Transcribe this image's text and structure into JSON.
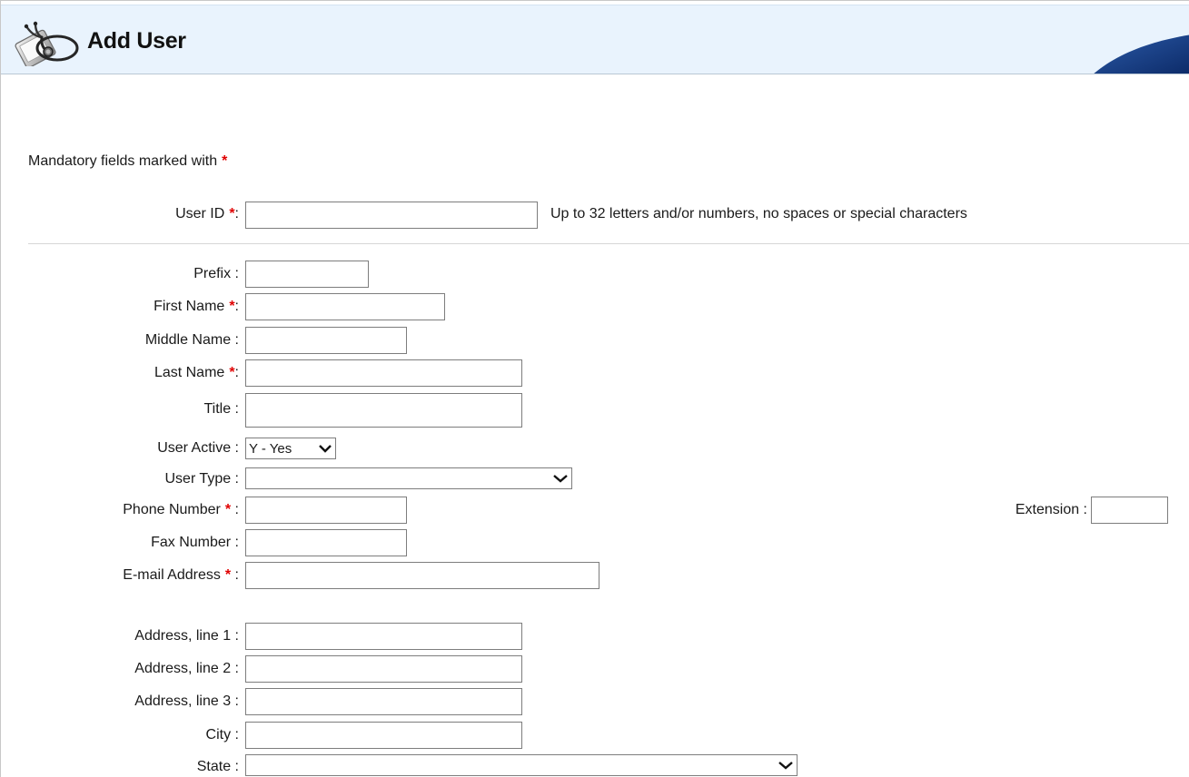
{
  "header": {
    "title": "Add User",
    "icon": "stethoscope-clipboard-icon"
  },
  "mandatory_note": {
    "text": "Mandatory fields marked with",
    "marker": "*"
  },
  "user_id": {
    "label": "User ID",
    "required": true,
    "value": "",
    "hint": "Up to 32 letters and/or numbers, no spaces or special characters"
  },
  "fields": {
    "prefix": {
      "label": "Prefix",
      "value": ""
    },
    "first_name": {
      "label": "First Name",
      "value": ""
    },
    "middle_name": {
      "label": "Middle Name",
      "value": ""
    },
    "last_name": {
      "label": "Last Name",
      "value": ""
    },
    "title": {
      "label": "Title",
      "value": ""
    },
    "user_active": {
      "label": "User Active",
      "value": "Y - Yes"
    },
    "user_type": {
      "label": "User Type",
      "value": ""
    },
    "phone_number": {
      "label": "Phone Number",
      "value": ""
    },
    "extension": {
      "label": "Extension",
      "value": ""
    },
    "fax_number": {
      "label": "Fax Number",
      "value": ""
    },
    "email": {
      "label": "E-mail Address",
      "value": ""
    },
    "address1": {
      "label": "Address, line 1",
      "value": ""
    },
    "address2": {
      "label": "Address, line 2",
      "value": ""
    },
    "address3": {
      "label": "Address, line 3",
      "value": ""
    },
    "city": {
      "label": "City",
      "value": ""
    },
    "state": {
      "label": "State",
      "value": ""
    }
  },
  "colors": {
    "required_star": "#e00000",
    "header_bg": "#e9f3fd"
  }
}
